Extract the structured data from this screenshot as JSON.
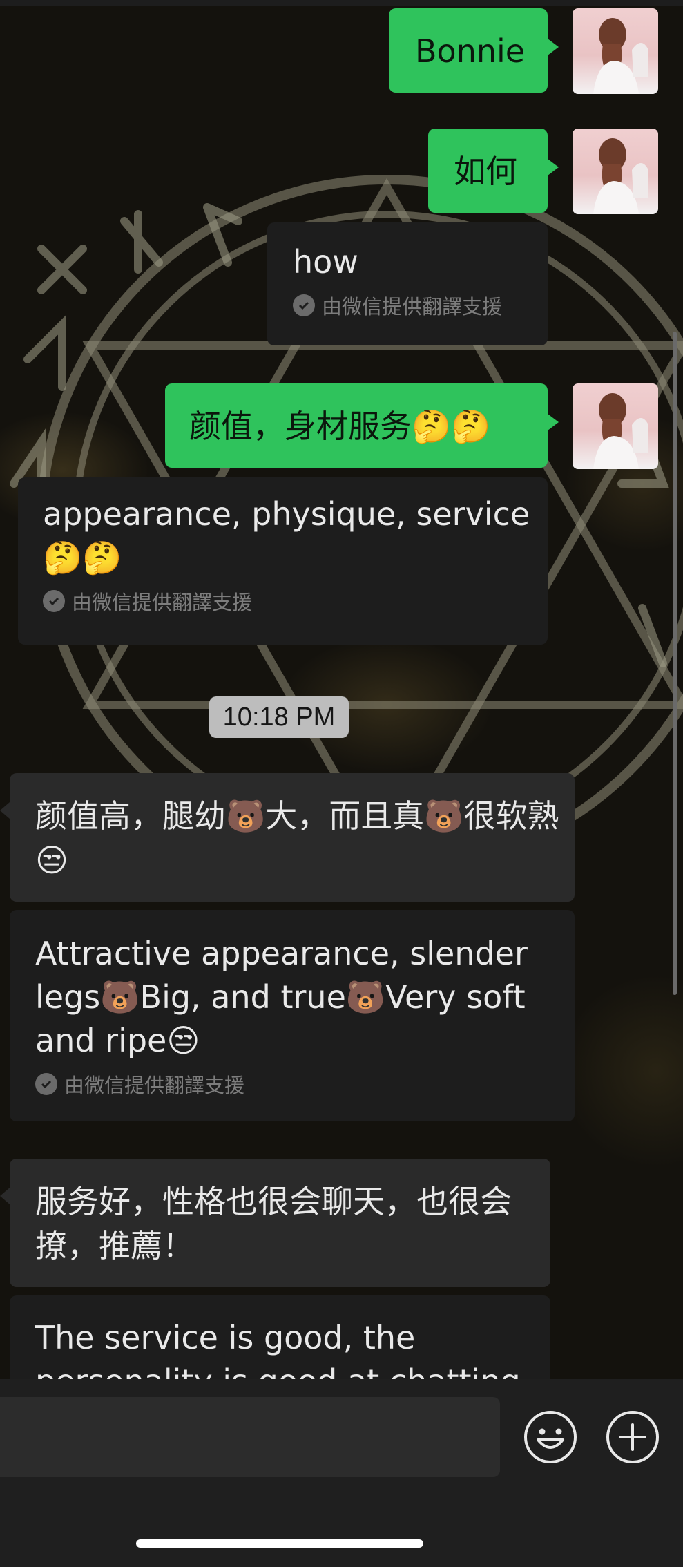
{
  "messages": {
    "m1": {
      "text": "Bonnie"
    },
    "m2": {
      "text": "如何"
    },
    "m2_translation": {
      "text": "how",
      "note": "由微信提供翻譯支援"
    },
    "m3": {
      "text": "颜值，身材服务🤔🤔"
    },
    "m3_translation": {
      "text": "appearance, physique, service 🤔🤔",
      "note": "由微信提供翻譯支援"
    },
    "timestamp": "10:18 PM",
    "m4": {
      "text": "颜值高，腿幼🐻大，而且真🐻很软熟😒"
    },
    "m4_translation": {
      "text": "Attractive appearance, slender legs🐻Big, and true🐻Very soft and ripe😒",
      "note": "由微信提供翻譯支援"
    },
    "m5": {
      "text": "服务好，性格也很会聊天，也很会撩，推薦！"
    },
    "m5_translation": {
      "text": "The service is good, the personality is good at chatting"
    }
  },
  "icons": {
    "emoji_button": "smiley-icon",
    "plus_button": "plus-circle-icon",
    "translation_check": "check-circle-icon"
  },
  "colors": {
    "sent_bubble": "#2fc35c",
    "received_bubble": "#2a2a2a",
    "translation_bubble": "#1d1d1d",
    "timestamp_pill": "#bdbdbd"
  }
}
